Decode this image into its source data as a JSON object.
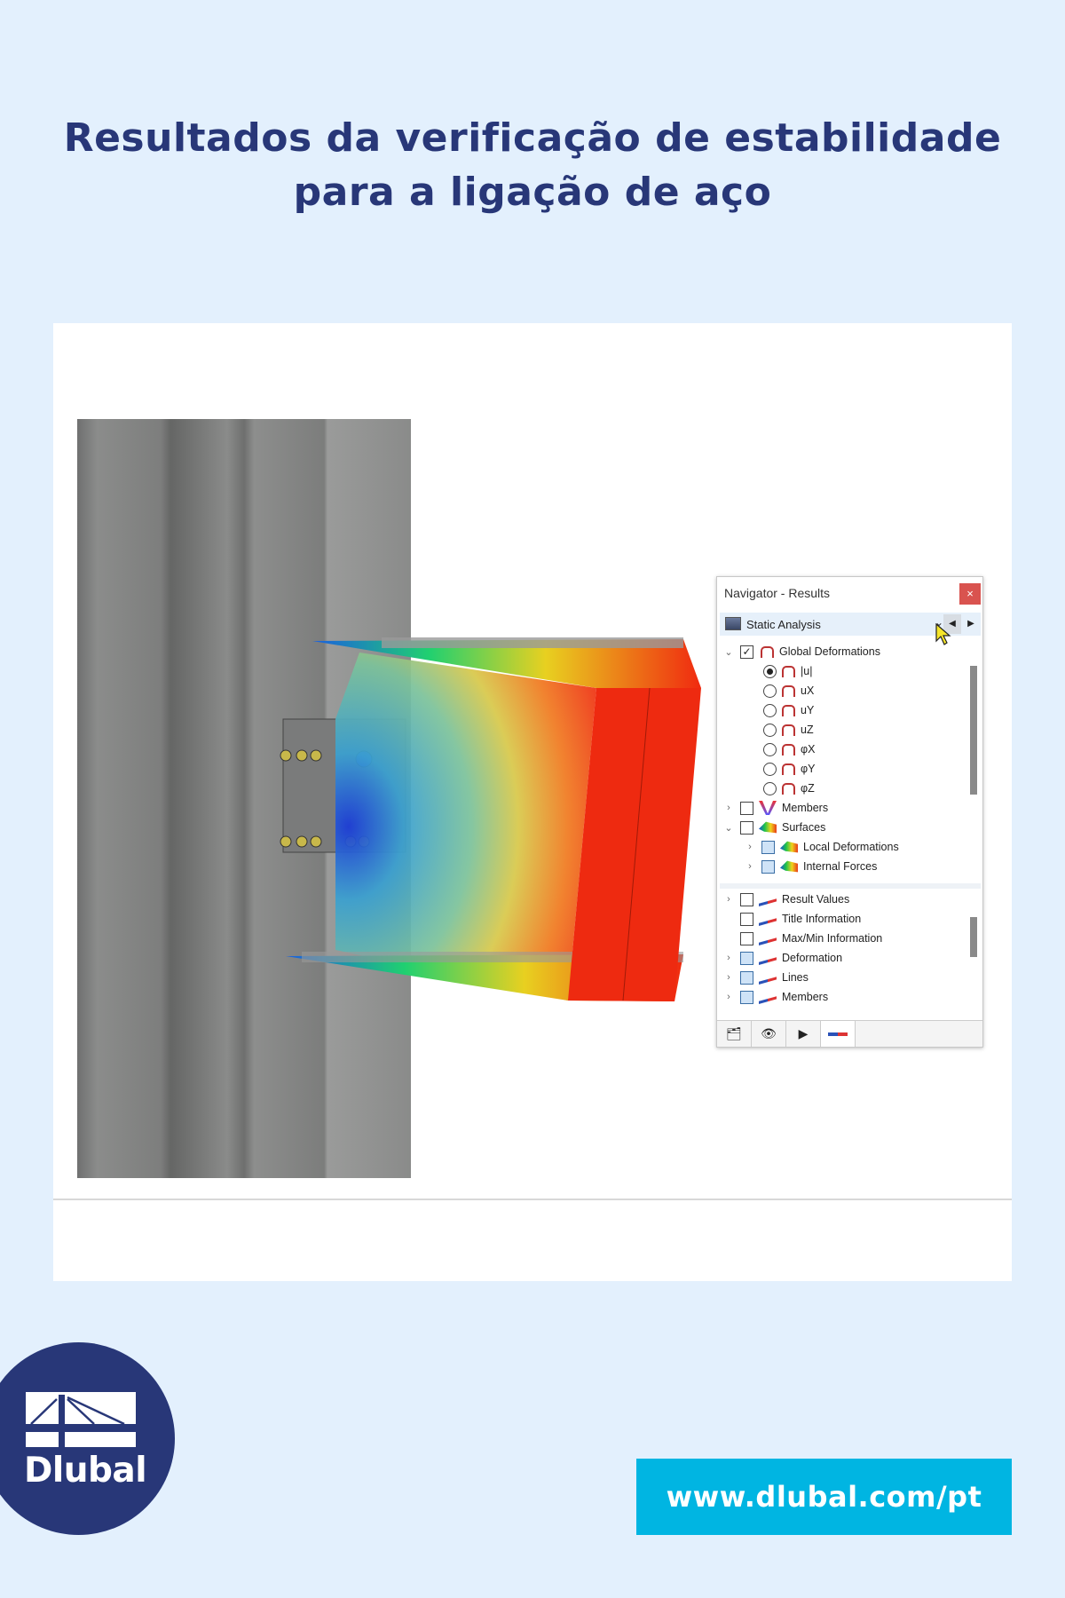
{
  "header": {
    "title_line1": "Resultados da verificação de estabilidade",
    "title_line2": "para a ligação de aço"
  },
  "navigator": {
    "title": "Navigator - Results",
    "close_label": "×",
    "combo": {
      "selected": "Static Analysis"
    },
    "tree_top": [
      {
        "label": "Global Deformations",
        "type": "checkbox",
        "checked": true,
        "expanded": true,
        "icon": "deformation-icon"
      },
      {
        "label": "|u|",
        "type": "radio",
        "selected": true,
        "icon": "deformation-icon"
      },
      {
        "label": "uX",
        "type": "radio",
        "selected": false,
        "icon": "deformation-icon"
      },
      {
        "label": "uY",
        "type": "radio",
        "selected": false,
        "icon": "deformation-icon"
      },
      {
        "label": "uZ",
        "type": "radio",
        "selected": false,
        "icon": "deformation-icon"
      },
      {
        "label": "φX",
        "type": "radio",
        "selected": false,
        "icon": "deformation-icon"
      },
      {
        "label": "φY",
        "type": "radio",
        "selected": false,
        "icon": "deformation-icon"
      },
      {
        "label": "φZ",
        "type": "radio",
        "selected": false,
        "icon": "deformation-icon"
      },
      {
        "label": "Members",
        "type": "checkbox",
        "checked": false,
        "expanded": false,
        "icon": "members-icon"
      },
      {
        "label": "Surfaces",
        "type": "checkbox",
        "checked": false,
        "expanded": true,
        "icon": "surfaces-icon"
      },
      {
        "label": "Local Deformations",
        "type": "checkbox",
        "checked": false,
        "expanded": false,
        "icon": "surfaces-icon"
      },
      {
        "label": "Internal Forces",
        "type": "checkbox",
        "checked": false,
        "expanded": false,
        "icon": "surfaces-icon"
      }
    ],
    "tree_bottom": [
      {
        "label": "Result Values",
        "icon": "result-values-icon"
      },
      {
        "label": "Title Information",
        "icon": "eye-icon"
      },
      {
        "label": "Max/Min Information",
        "icon": "eye-icon"
      },
      {
        "label": "Deformation",
        "icon": "eye-icon"
      },
      {
        "label": "Lines",
        "icon": "eye-icon"
      },
      {
        "label": "Members",
        "icon": "eye-icon"
      }
    ],
    "tabs": [
      "data-icon",
      "view-icon",
      "camera-icon",
      "results-icon"
    ]
  },
  "logo": {
    "text": "Dlubal"
  },
  "footer": {
    "url": "www.dlubal.com/pt"
  },
  "colors": {
    "background": "#e3f0fd",
    "title": "#283778",
    "logo": "#283778",
    "url_box": "#00b5e2",
    "close": "#d9534f"
  }
}
